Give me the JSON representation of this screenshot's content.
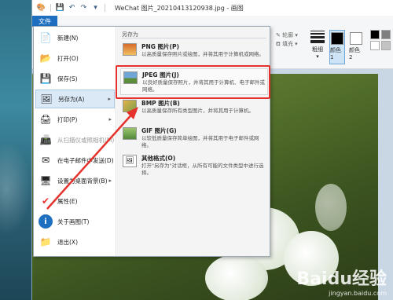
{
  "window": {
    "title": "WeChat 图片_20210413120938.jpg - 画图"
  },
  "ribbon": {
    "file_tab": "文件",
    "outline_label": "轮廓",
    "fill_label": "填充",
    "thickness_label": "粗细",
    "color1_label": "颜色 1",
    "color2_label": "颜色 2"
  },
  "file_menu": {
    "items": [
      {
        "label": "新建(N)",
        "icon": "new-file-icon"
      },
      {
        "label": "打开(O)",
        "icon": "open-folder-icon"
      },
      {
        "label": "保存(S)",
        "icon": "save-disk-icon"
      },
      {
        "label": "另存为(A)",
        "icon": "save-as-icon"
      },
      {
        "label": "打印(P)",
        "icon": "printer-icon"
      },
      {
        "label": "从扫描仪或照相机(M)",
        "icon": "scanner-icon"
      },
      {
        "label": "在电子邮件中发送(D)",
        "icon": "email-icon"
      },
      {
        "label": "设置为桌面背景(B)",
        "icon": "desktop-background-icon"
      },
      {
        "label": "属性(E)",
        "icon": "properties-check-icon"
      },
      {
        "label": "关于画图(T)",
        "icon": "info-icon"
      },
      {
        "label": "退出(X)",
        "icon": "exit-icon"
      }
    ],
    "submenu_header": "另存为",
    "submenu": [
      {
        "title": "PNG 图片(P)",
        "desc": "以高质量保存照片或绘图，并将其用于计算机或网络。",
        "icon": "png-image-icon"
      },
      {
        "title": "JPEG 图片(J)",
        "desc": "以良好质量保存照片，并将其用于计算机、电子邮件或网络。",
        "icon": "jpeg-image-icon"
      },
      {
        "title": "BMP 图片(B)",
        "desc": "以高质量保存所有类型图片，并将其用于计算机。",
        "icon": "bmp-image-icon"
      },
      {
        "title": "GIF 图片(G)",
        "desc": "以较低质量保存简单绘图，并将其用于电子邮件或网络。",
        "icon": "gif-image-icon"
      },
      {
        "title": "其他格式(O)",
        "desc": "打开\"另存为\"对话框，从所有可能的文件类型中进行选择。",
        "icon": "other-formats-icon"
      }
    ]
  },
  "watermark": {
    "main": "Baidu经验",
    "sub": "jingyan.baidu.com"
  },
  "colors": {
    "accent": "#1e6fc0",
    "annotation": "#e5322d"
  }
}
